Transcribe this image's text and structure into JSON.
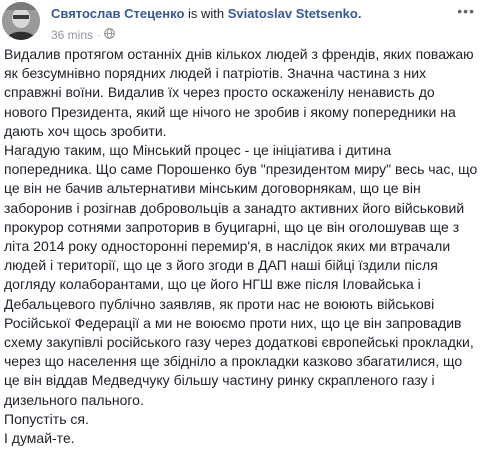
{
  "post": {
    "author_name": "Святослав Стеценко",
    "with_text": " is with ",
    "tagged_name": "Sviatoslav Stetsenko.",
    "timestamp": "36 mins",
    "dot": "·",
    "privacy_icon": "globe-icon",
    "more_icon": "ellipsis-icon",
    "more_label": "•••",
    "paragraphs": [
      "Видалив протягом останніх днів кількох людей з френдів, яких поважаю як безсумнівно порядних людей і патріотів. Значна частина з них справжні воїни. Видалив їх через просто оскаженілу ненависть до нового Президента, який ще нічого не зробив і якому попередники на дають хоч щось зробити.",
      "Нагадую таким, що Мінський процес - це ініціатива і дитина попередника. Що саме Порошенко був \"президентом миру\" весь час, що це він не бачив альтернативи мінським договорнякам, що це він заборонив і розігнав добровольців а занадто активних його військовий прокурор сотнями запроторив в буцигарні, що це він оголошував ще з літа 2014 року односторонні перемир'я, в наслідок яких ми втрачали людей і території, що це з його згоди в ДАП наші бійці їздили після догляду колаборантами, що це його НГШ вже після Іловайська і Дебальцевого публічно заявляв, як проти нас не воюють військові Російської Федерації а ми не воюємо проти них, що це він запровадив схему закупівлі російського газу через додаткові європейські прокладки, через що населення ще збідніло а прокладки казково збагатилися, що це він віддав Медведчуку більшу частину ринку скрапленого газу і дизельного пального.",
      "Попустіть ся.",
      "І думай-те."
    ]
  }
}
